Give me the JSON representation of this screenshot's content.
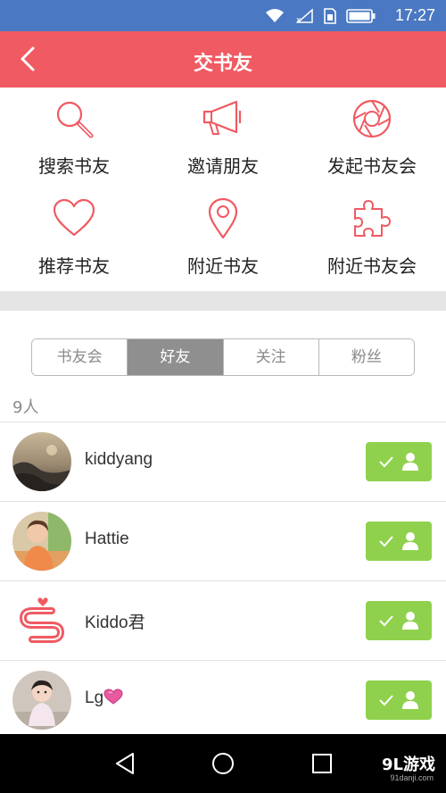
{
  "status_bar": {
    "time": "17:27",
    "icons": [
      "wifi-icon",
      "signal-off-icon",
      "sim-icon",
      "battery-icon"
    ]
  },
  "header": {
    "title": "交书友",
    "back_icon": "chevron-left-icon",
    "color": "#f05a62"
  },
  "features": [
    {
      "label": "搜索书友",
      "icon": "search-icon"
    },
    {
      "label": "邀请朋友",
      "icon": "megaphone-icon"
    },
    {
      "label": "发起书友会",
      "icon": "aperture-icon"
    },
    {
      "label": "推荐书友",
      "icon": "heart-icon"
    },
    {
      "label": "附近书友",
      "icon": "location-pin-icon"
    },
    {
      "label": "附近书友会",
      "icon": "puzzle-icon"
    }
  ],
  "tabs": [
    {
      "label": "书友会",
      "active": false
    },
    {
      "label": "好友",
      "active": true
    },
    {
      "label": "关注",
      "active": false
    },
    {
      "label": "粉丝",
      "active": false
    }
  ],
  "count_label": "9人",
  "friends": [
    {
      "name": "kiddyang",
      "avatar": "landscape-photo"
    },
    {
      "name": "Hattie",
      "avatar": "child-photo"
    },
    {
      "name": "Kiddo君",
      "avatar": "brand-logo"
    },
    {
      "name": "Lg",
      "avatar": "baby-photo",
      "suffix_icon": "heart-badge-icon"
    }
  ],
  "follow_button_icon": "check-user-icon",
  "accent_green": "#8fd14c",
  "navbar": {
    "watermark": "9L游戏",
    "watermark_sub": "91danji.com"
  }
}
